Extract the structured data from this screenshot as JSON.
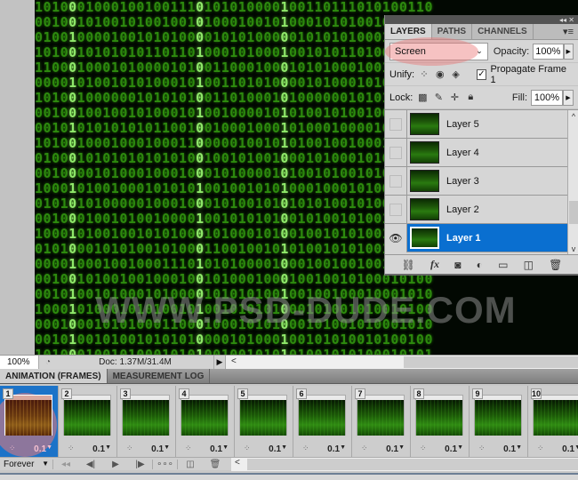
{
  "canvas": {
    "watermark": "WWW.PSD-DUDE.COM",
    "rows": [
      "10100010001001001110101010000100110111010100110",
      "00100101001010010010100010010100010101001001010",
      "01001000010010101000010101000001010101000101001",
      "10100101010101101101000101000100101011010000101",
      "11000100010100001010011000100010101000100110010",
      "00001010010101000101001101010000101000101000101",
      "10100100000010101010011010001010000001010100101",
      "00100100100101000101001000010101001010010010100",
      "00101010101010110010010001000101000100001010100",
      "10100100010001000110000010010101001001000101010",
      "01000101010101010100100101001000101000101010100",
      "00100001010001000100010100001010010100101010001",
      "10001010010001010101001001010100010001010010100",
      "01010101000001000100010100101010101001010001010",
      "00100010010100100001001010101001010010100100101",
      "10001010010010101000101000101001001010100101001",
      "01010001010100101000110010010101001010100100100",
      "00001000100100011101010100001000100100100100101",
      "00100101001001000100101000100010010010100010100",
      "00101001010001010000101010100100100100010001010",
      "10001010001010100101001010101000101001010010100",
      "00010001010100011000100010101000101001010001010",
      "00101001010010101010000101000100101010010100100",
      "10100010010100010101001001010101001010100010101"
    ]
  },
  "layers_panel": {
    "tabs": [
      "LAYERS",
      "PATHS",
      "CHANNELS"
    ],
    "active_tab": "LAYERS",
    "menu_icon": "panel-menu-icon",
    "collapse_icon": "collapse-icon",
    "blend_mode": "Screen",
    "opacity_label": "Opacity:",
    "opacity_value": "100%",
    "unify_label": "Unify:",
    "propagate_label": "Propagate Frame 1",
    "propagate_checked": true,
    "lock_label": "Lock:",
    "fill_label": "Fill:",
    "fill_value": "100%",
    "layers": [
      {
        "name": "Layer 5",
        "visible": false,
        "selected": false
      },
      {
        "name": "Layer 4",
        "visible": false,
        "selected": false
      },
      {
        "name": "Layer 3",
        "visible": false,
        "selected": false
      },
      {
        "name": "Layer 2",
        "visible": false,
        "selected": false
      },
      {
        "name": "Layer 1",
        "visible": true,
        "selected": true
      }
    ],
    "footer_icons": [
      "link-layers-icon",
      "fx-icon",
      "add-mask-icon",
      "adjustment-layer-icon",
      "new-group-icon",
      "new-layer-icon",
      "delete-icon"
    ]
  },
  "statusbar": {
    "zoom": "100%",
    "doc_info": "Doc: 1.37M/31.4M"
  },
  "animation_panel": {
    "tabs": [
      "ANIMATION (FRAMES)",
      "MEASUREMENT LOG"
    ],
    "active_tab": "ANIMATION (FRAMES)",
    "frames": [
      {
        "number": "1",
        "delay": "0.1",
        "selected": true
      },
      {
        "number": "2",
        "delay": "0.1",
        "selected": false
      },
      {
        "number": "3",
        "delay": "0.1",
        "selected": false
      },
      {
        "number": "4",
        "delay": "0.1",
        "selected": false
      },
      {
        "number": "5",
        "delay": "0.1",
        "selected": false
      },
      {
        "number": "6",
        "delay": "0.1",
        "selected": false
      },
      {
        "number": "7",
        "delay": "0.1",
        "selected": false
      },
      {
        "number": "8",
        "delay": "0.1",
        "selected": false
      },
      {
        "number": "9",
        "delay": "0.1",
        "selected": false
      },
      {
        "number": "10",
        "delay": "0.1",
        "selected": false
      }
    ],
    "loop_option": "Forever",
    "controls": [
      "first-frame-icon",
      "previous-frame-icon",
      "play-icon",
      "next-frame-icon",
      "tween-icon",
      "duplicate-frame-icon",
      "delete-frame-icon"
    ]
  }
}
